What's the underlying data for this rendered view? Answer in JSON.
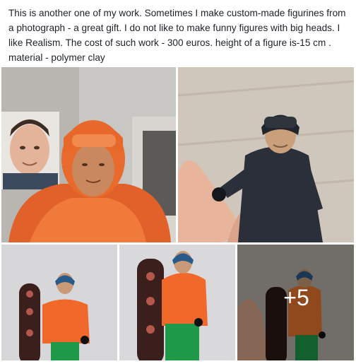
{
  "post": {
    "text": "This is another one of my work. Sometimes I make custom-made figurines from a photograph - a great gift. I do not like to make funny figures with big heads. I like Realism. The cost of such work - 300 euros. height of a figure is-15 cm . material - polymer clay"
  },
  "gallery": {
    "more_count": "+5",
    "photos": [
      {
        "name": "photo-orange-figure-with-reference-portrait"
      },
      {
        "name": "photo-black-jacket-figure-in-hand"
      },
      {
        "name": "photo-snowboarder-figure-front"
      },
      {
        "name": "photo-snowboarder-figure-side"
      },
      {
        "name": "photo-snowboarder-figure-in-hand"
      }
    ]
  },
  "colors": {
    "text": "#1d2129",
    "orange_jacket": "#e8651f",
    "black_jacket": "#2a2e36",
    "green_pants": "#1f9a4a",
    "board": "#3a1f1d"
  }
}
